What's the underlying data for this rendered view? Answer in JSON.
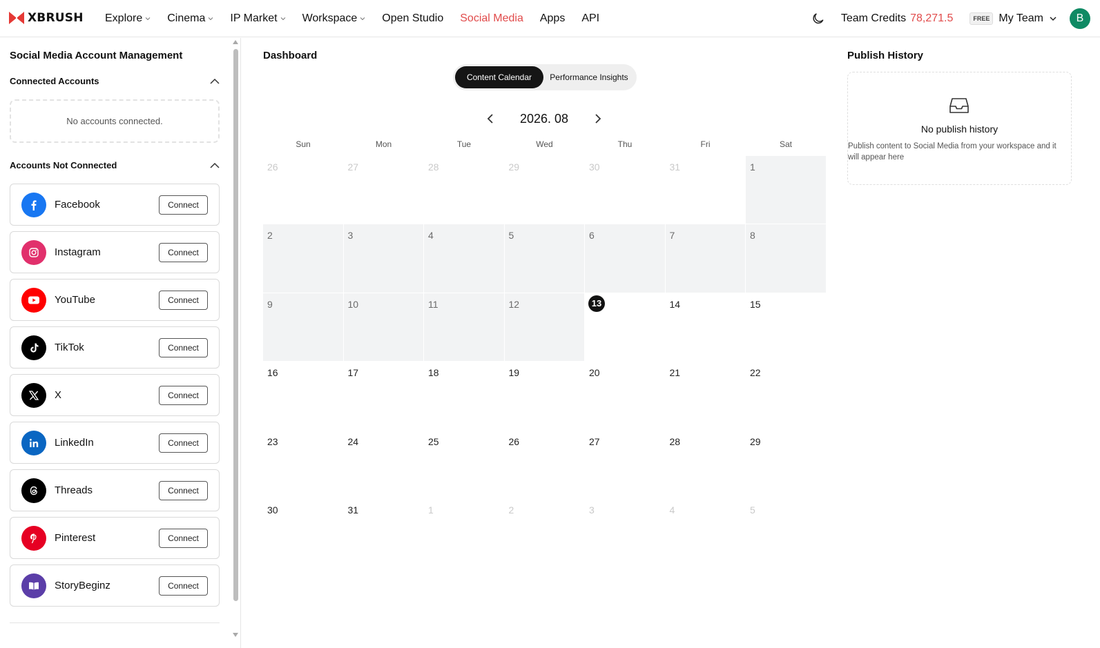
{
  "header": {
    "logo_text": "XBRUSH",
    "nav": [
      {
        "label": "Explore",
        "has_caret": true,
        "active": false
      },
      {
        "label": "Cinema",
        "has_caret": true,
        "active": false
      },
      {
        "label": "IP Market",
        "has_caret": true,
        "active": false
      },
      {
        "label": "Workspace",
        "has_caret": true,
        "active": false
      },
      {
        "label": "Open Studio",
        "has_caret": false,
        "active": false
      },
      {
        "label": "Social Media",
        "has_caret": false,
        "active": true
      },
      {
        "label": "Apps",
        "has_caret": false,
        "active": false
      },
      {
        "label": "API",
        "has_caret": false,
        "active": false
      }
    ],
    "credits_label": "Team Credits",
    "credits_value": "78,271.5",
    "plan_badge": "FREE",
    "team_name": "My Team",
    "avatar_initial": "B"
  },
  "left_panel": {
    "title": "Social Media Account Management",
    "connected_heading": "Connected Accounts",
    "connected_empty": "No accounts connected.",
    "not_connected_heading": "Accounts Not Connected",
    "connect_label": "Connect",
    "accounts": [
      {
        "name": "Facebook",
        "icon": "facebook-icon",
        "color": "#1877f2"
      },
      {
        "name": "Instagram",
        "icon": "instagram-icon",
        "color": "#e1306c"
      },
      {
        "name": "YouTube",
        "icon": "youtube-icon",
        "color": "#ff0000"
      },
      {
        "name": "TikTok",
        "icon": "tiktok-icon",
        "color": "#000000"
      },
      {
        "name": "X",
        "icon": "x-icon",
        "color": "#000000"
      },
      {
        "name": "LinkedIn",
        "icon": "linkedin-icon",
        "color": "#0a66c2"
      },
      {
        "name": "Threads",
        "icon": "threads-icon",
        "color": "#000000"
      },
      {
        "name": "Pinterest",
        "icon": "pinterest-icon",
        "color": "#e60023"
      },
      {
        "name": "StoryBeginz",
        "icon": "storybeginz-icon",
        "color": "#5b3ea8"
      }
    ]
  },
  "dashboard": {
    "title": "Dashboard",
    "tabs": [
      {
        "label": "Content Calendar",
        "active": true
      },
      {
        "label": "Performance Insights",
        "active": false
      }
    ],
    "month_label": "2026. 08",
    "weekdays": [
      "Sun",
      "Mon",
      "Tue",
      "Wed",
      "Thu",
      "Fri",
      "Sat"
    ],
    "today": 13,
    "days": [
      {
        "n": "26",
        "month": "prev"
      },
      {
        "n": "27",
        "month": "prev"
      },
      {
        "n": "28",
        "month": "prev"
      },
      {
        "n": "29",
        "month": "prev"
      },
      {
        "n": "30",
        "month": "prev"
      },
      {
        "n": "31",
        "month": "prev"
      },
      {
        "n": "1",
        "month": "cur",
        "past": true
      },
      {
        "n": "2",
        "month": "cur",
        "past": true
      },
      {
        "n": "3",
        "month": "cur",
        "past": true
      },
      {
        "n": "4",
        "month": "cur",
        "past": true
      },
      {
        "n": "5",
        "month": "cur",
        "past": true
      },
      {
        "n": "6",
        "month": "cur",
        "past": true
      },
      {
        "n": "7",
        "month": "cur",
        "past": true
      },
      {
        "n": "8",
        "month": "cur",
        "past": true
      },
      {
        "n": "9",
        "month": "cur",
        "past": true
      },
      {
        "n": "10",
        "month": "cur",
        "past": true
      },
      {
        "n": "11",
        "month": "cur",
        "past": true
      },
      {
        "n": "12",
        "month": "cur",
        "past": true
      },
      {
        "n": "13",
        "month": "cur",
        "today": true
      },
      {
        "n": "14",
        "month": "cur"
      },
      {
        "n": "15",
        "month": "cur"
      },
      {
        "n": "16",
        "month": "cur"
      },
      {
        "n": "17",
        "month": "cur"
      },
      {
        "n": "18",
        "month": "cur"
      },
      {
        "n": "19",
        "month": "cur"
      },
      {
        "n": "20",
        "month": "cur"
      },
      {
        "n": "21",
        "month": "cur"
      },
      {
        "n": "22",
        "month": "cur"
      },
      {
        "n": "23",
        "month": "cur"
      },
      {
        "n": "24",
        "month": "cur"
      },
      {
        "n": "25",
        "month": "cur"
      },
      {
        "n": "26",
        "month": "cur"
      },
      {
        "n": "27",
        "month": "cur"
      },
      {
        "n": "28",
        "month": "cur"
      },
      {
        "n": "29",
        "month": "cur"
      },
      {
        "n": "30",
        "month": "cur"
      },
      {
        "n": "31",
        "month": "cur"
      },
      {
        "n": "1",
        "month": "next"
      },
      {
        "n": "2",
        "month": "next"
      },
      {
        "n": "3",
        "month": "next"
      },
      {
        "n": "4",
        "month": "next"
      },
      {
        "n": "5",
        "month": "next"
      }
    ]
  },
  "publish_history": {
    "title": "Publish History",
    "empty_title": "No publish history",
    "empty_desc": "Publish content to Social Media from your workspace and it will appear here"
  },
  "colors": {
    "accent": "#e14b4b",
    "avatar_bg": "#0f8a64",
    "today_bg": "#121212",
    "past_cell_bg": "#f2f3f4"
  }
}
